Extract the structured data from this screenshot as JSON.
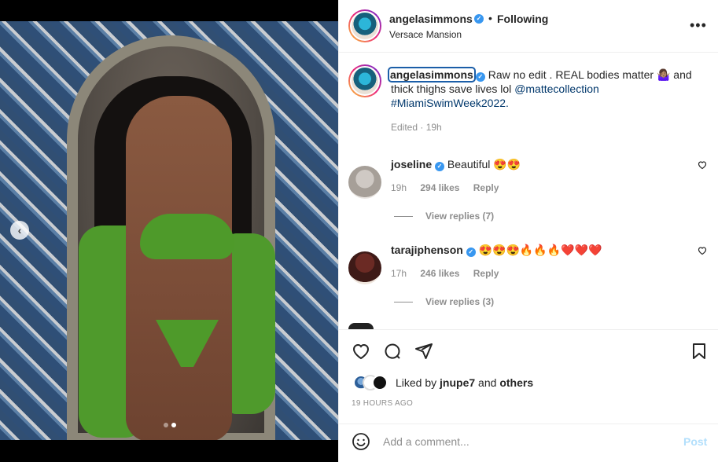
{
  "post": {
    "username": "angelasimmons",
    "separator": "•",
    "follow_status": "Following",
    "location": "Versace Mansion",
    "more_label": "•••"
  },
  "caption": {
    "username": "angelasimmons",
    "text_before": " Raw no edit . REAL bodies matter 🤷🏽‍♀️ and thick thighs save lives lol ",
    "mention": "@mattecollection",
    "hashtag": "#MiamiSwimWeek2022.",
    "edited_label": "Edited · 19h"
  },
  "comments": [
    {
      "username": "joseline",
      "text": "Beautiful 😍😍",
      "time": "19h",
      "likes": "294 likes",
      "reply_label": "Reply",
      "view_replies": "View replies (7)"
    },
    {
      "username": "tarajiphenson",
      "text": "😍😍😍🔥🔥🔥❤️❤️❤️",
      "time": "17h",
      "likes": "246 likes",
      "reply_label": "Reply",
      "view_replies": "View replies (3)"
    }
  ],
  "likes": {
    "prefix": "Liked by ",
    "user": "jnupe7",
    "connector": " and ",
    "others": "others"
  },
  "timestamp": "19 HOURS AGO",
  "composer": {
    "placeholder": "Add a comment...",
    "post_label": "Post"
  },
  "carousel": {
    "slide_count": 2,
    "active_index": 1,
    "prev_label": "‹"
  }
}
